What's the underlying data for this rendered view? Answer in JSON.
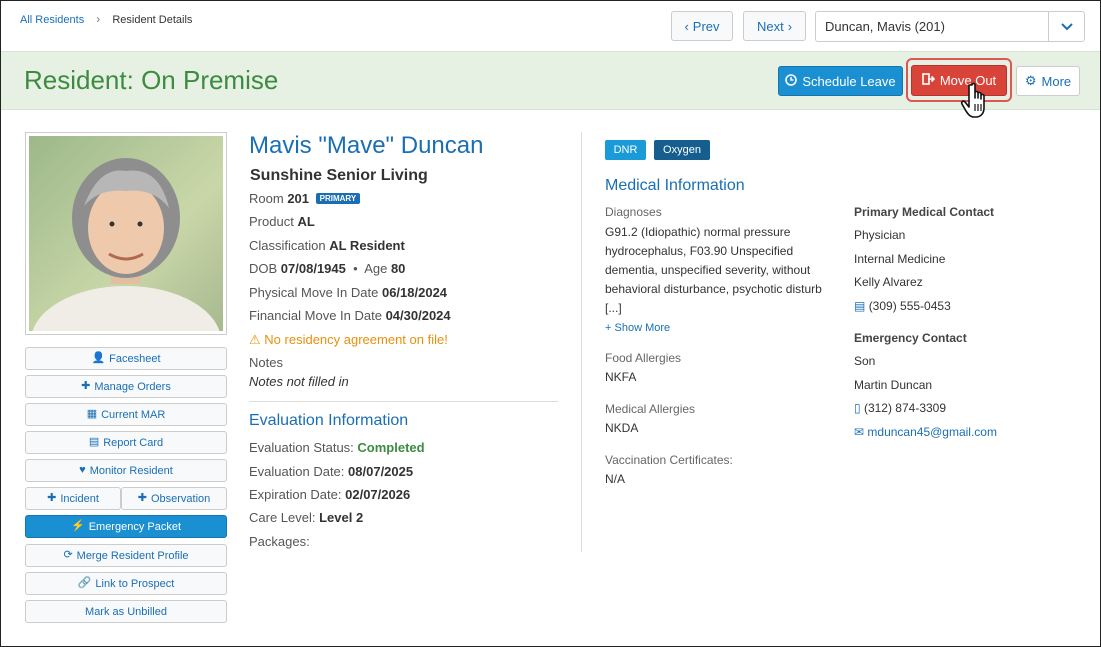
{
  "breadcrumb": {
    "home": "All Residents",
    "current": "Resident Details"
  },
  "nav": {
    "prev": "Prev",
    "next": "Next",
    "resident_selected": "Duncan, Mavis (201)"
  },
  "banner": {
    "title": "Resident: On Premise",
    "schedule_leave": "Schedule Leave",
    "move_out": "Move Out",
    "more": "More"
  },
  "actions": {
    "facesheet": "Facesheet",
    "manage_orders": "Manage Orders",
    "current_mar": "Current MAR",
    "report_card": "Report Card",
    "monitor_resident": "Monitor Resident",
    "incident": "Incident",
    "observation": "Observation",
    "emergency_packet": "Emergency Packet",
    "merge_profile": "Merge Resident Profile",
    "link_prospect": "Link to Prospect",
    "mark_unbilled": "Mark as Unbilled"
  },
  "resident": {
    "name": "Mavis \"Mave\" Duncan",
    "facility": "Sunshine Senior Living",
    "room_label": "Room",
    "room": "201",
    "room_badge": "PRIMARY",
    "product_label": "Product",
    "product": "AL",
    "classification_label": "Classification",
    "classification": "AL Resident",
    "dob_label": "DOB",
    "dob": "07/08/1945",
    "age_label": "Age",
    "age": "80",
    "physical_move_label": "Physical Move In Date",
    "physical_move": "06/18/2024",
    "financial_move_label": "Financial Move In Date",
    "financial_move": "04/30/2024",
    "warning": "No residency agreement on file!",
    "notes_label": "Notes",
    "notes": "Notes not filled in"
  },
  "evaluation": {
    "title": "Evaluation Information",
    "status_label": "Evaluation Status:",
    "status": "Completed",
    "date_label": "Evaluation Date:",
    "date": "08/07/2025",
    "expiration_label": "Expiration Date:",
    "expiration": "02/07/2026",
    "care_label": "Care Level:",
    "care": "Level 2",
    "packages_label": "Packages:"
  },
  "medical": {
    "tags": [
      "DNR",
      "Oxygen"
    ],
    "title": "Medical Information",
    "diagnoses_label": "Diagnoses",
    "diagnoses": "G91.2 (Idiopathic) normal pressure hydrocephalus, F03.90 Unspecified dementia, unspecified severity, without behavioral disturbance, psychotic disturb [...]",
    "show_more": "Show More",
    "food_label": "Food Allergies",
    "food": "NKFA",
    "med_allergies_label": "Medical Allergies",
    "med_allergies": "NKDA",
    "vaccination_label": "Vaccination Certificates:",
    "vaccination": "N/A"
  },
  "primary_contact": {
    "title": "Primary Medical Contact",
    "role": "Physician",
    "org": "Internal Medicine",
    "name": "Kelly Alvarez",
    "phone": "(309) 555-0453"
  },
  "emergency_contact": {
    "title": "Emergency Contact",
    "relation": "Son",
    "name": "Martin Duncan",
    "phone": "(312) 874-3309",
    "email": "mduncan45@gmail.com"
  },
  "colors": {
    "accent": "#1a6fb4",
    "banner_bg": "#e6f1e4",
    "banner_text": "#3d8b40",
    "danger": "#d9443a",
    "primary_btn": "#1a8fd1"
  }
}
